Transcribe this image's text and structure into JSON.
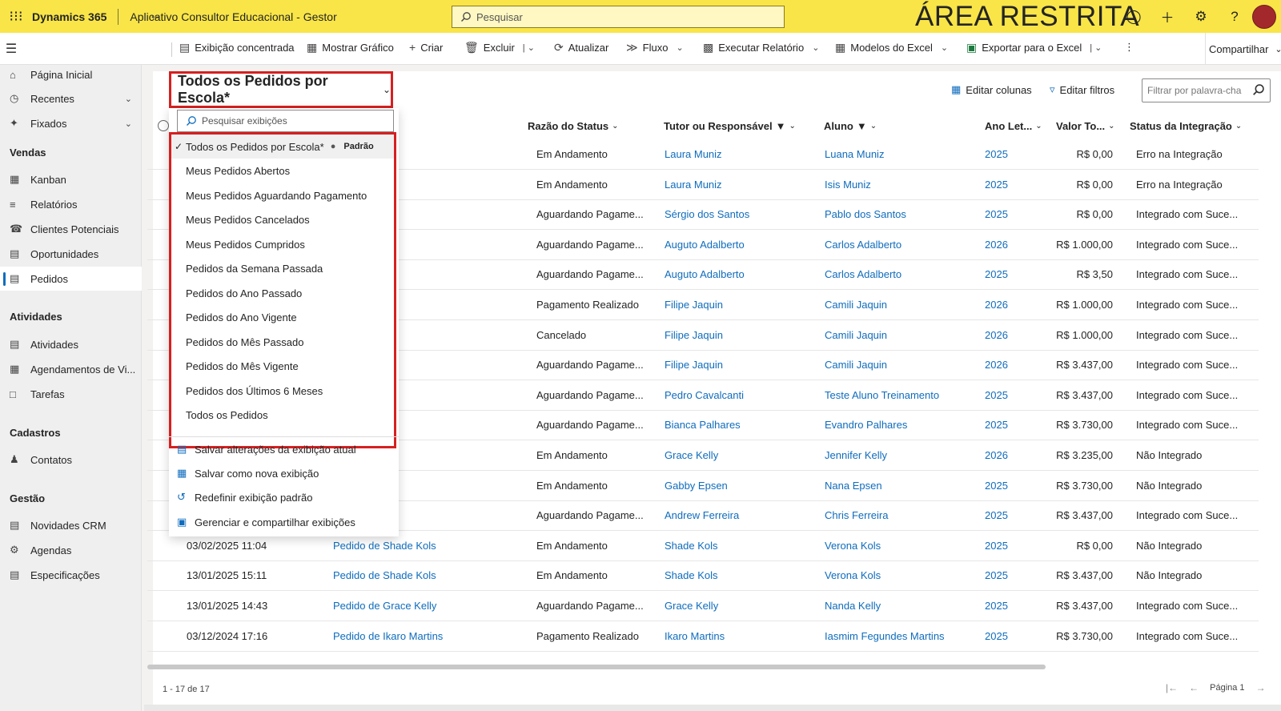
{
  "header": {
    "brand": "Dynamics 365",
    "app_name": "Aplicativo Consultor Educacional - Gestor",
    "search_placeholder": "Pesquisar",
    "restricted_label": "ÁREA RESTRITA"
  },
  "commands": {
    "focused_view": "Exibição concentrada",
    "show_chart": "Mostrar Gráfico",
    "create": "Criar",
    "delete": "Excluir",
    "refresh": "Atualizar",
    "flow": "Fluxo",
    "run_report": "Executar Relatório",
    "excel_templates": "Modelos do Excel",
    "export_excel": "Exportar para o Excel",
    "share": "Compartilhar"
  },
  "sidebar": {
    "home": "Página Inicial",
    "recent": "Recentes",
    "pinned": "Fixados",
    "sections": {
      "sales": "Vendas",
      "activities": "Atividades",
      "registers": "Cadastros",
      "management": "Gestão"
    },
    "items": {
      "kanban": "Kanban",
      "reports": "Relatórios",
      "leads": "Clientes Potenciais",
      "opportunities": "Oportunidades",
      "orders": "Pedidos",
      "activities": "Atividades",
      "visit_schedules": "Agendamentos de Vi...",
      "tasks": "Tarefas",
      "contacts": "Contatos",
      "crm_news": "Novidades CRM",
      "agendas": "Agendas",
      "specs": "Especificações"
    }
  },
  "view": {
    "title": "Todos os Pedidos por Escola*",
    "edit_columns": "Editar colunas",
    "edit_filters": "Editar filtros",
    "keyword_placeholder": "Filtrar por palavra-cha"
  },
  "columns": {
    "status_reason": "Razão do Status",
    "tutor": "Tutor ou Responsável",
    "student": "Aluno",
    "school_year": "Ano Let...",
    "total_value": "Valor To...",
    "integration_status": "Status da Integração"
  },
  "rows": [
    {
      "date": "",
      "order": "a Muniz",
      "status": "Em Andamento",
      "tutor": "Laura Muniz",
      "student": "Luana Muniz",
      "year": "2025",
      "value": "R$ 0,00",
      "integ": "Erro na Integração"
    },
    {
      "date": "",
      "order": "a Muniz",
      "status": "Em Andamento",
      "tutor": "Laura Muniz",
      "student": "Isis Muniz",
      "year": "2025",
      "value": "R$ 0,00",
      "integ": "Erro na Integração"
    },
    {
      "date": "",
      "order": "io dos Santos",
      "status": "Aguardando Pagame...",
      "tutor": "Sérgio dos Santos",
      "student": "Pablo dos Santos",
      "year": "2025",
      "value": "R$ 0,00",
      "integ": "Integrado com Suce..."
    },
    {
      "date": "",
      "order": "uto Adalberto",
      "status": "Aguardando Pagame...",
      "tutor": "Auguto Adalberto",
      "student": "Carlos Adalberto",
      "year": "2026",
      "value": "R$ 1.000,00",
      "integ": "Integrado com Suce..."
    },
    {
      "date": "",
      "order": "uto Adalberto",
      "status": "Aguardando Pagame...",
      "tutor": "Auguto Adalberto",
      "student": "Carlos Adalberto",
      "year": "2025",
      "value": "R$ 3,50",
      "integ": "Integrado com Suce..."
    },
    {
      "date": "",
      "order": "e Jaquin",
      "status": "Pagamento Realizado",
      "tutor": "Filipe Jaquin",
      "student": "Camili Jaquin",
      "year": "2026",
      "value": "R$ 1.000,00",
      "integ": "Integrado com Suce..."
    },
    {
      "date": "",
      "order": "e Jaquin",
      "status": "Cancelado",
      "tutor": "Filipe Jaquin",
      "student": "Camili Jaquin",
      "year": "2026",
      "value": "R$ 1.000,00",
      "integ": "Integrado com Suce..."
    },
    {
      "date": "",
      "order": "e Jaquin",
      "status": "Aguardando Pagame...",
      "tutor": "Filipe Jaquin",
      "student": "Camili Jaquin",
      "year": "2026",
      "value": "R$ 3.437,00",
      "integ": "Integrado com Suce..."
    },
    {
      "date": "",
      "order": "o Cavalcanti",
      "status": "Aguardando Pagame...",
      "tutor": "Pedro Cavalcanti",
      "student": "Teste Aluno Treinamento",
      "year": "2025",
      "value": "R$ 3.437,00",
      "integ": "Integrado com Suce..."
    },
    {
      "date": "",
      "order": "ca Palhares",
      "status": "Aguardando Pagame...",
      "tutor": "Bianca Palhares",
      "student": "Evandro Palhares",
      "year": "2025",
      "value": "R$ 3.730,00",
      "integ": "Integrado com Suce..."
    },
    {
      "date": "",
      "order": "e Kelly",
      "status": "Em Andamento",
      "tutor": "Grace Kelly",
      "student": "Jennifer Kelly",
      "year": "2026",
      "value": "R$ 3.235,00",
      "integ": "Não Integrado"
    },
    {
      "date": "",
      "order": "by Epsen",
      "status": "Em Andamento",
      "tutor": "Gabby Epsen",
      "student": "Nana Epsen",
      "year": "2025",
      "value": "R$ 3.730,00",
      "integ": "Não Integrado"
    },
    {
      "date": "",
      "order": "rew Ferreira",
      "status": "Aguardando Pagame...",
      "tutor": "Andrew Ferreira",
      "student": "Chris Ferreira",
      "year": "2025",
      "value": "R$ 3.437,00",
      "integ": "Integrado com Suce..."
    },
    {
      "date": "03/02/2025 11:04",
      "order": "Pedido de Shade Kols",
      "status": "Em Andamento",
      "tutor": "Shade Kols",
      "student": "Verona Kols",
      "year": "2025",
      "value": "R$ 0,00",
      "integ": "Não Integrado"
    },
    {
      "date": "13/01/2025 15:11",
      "order": "Pedido de Shade Kols",
      "status": "Em Andamento",
      "tutor": "Shade Kols",
      "student": "Verona Kols",
      "year": "2025",
      "value": "R$ 3.437,00",
      "integ": "Não Integrado"
    },
    {
      "date": "13/01/2025 14:43",
      "order": "Pedido de Grace Kelly",
      "status": "Aguardando Pagame...",
      "tutor": "Grace Kelly",
      "student": "Nanda Kelly",
      "year": "2025",
      "value": "R$ 3.437,00",
      "integ": "Integrado com Suce..."
    },
    {
      "date": "03/12/2024 17:16",
      "order": "Pedido de Ikaro Martins",
      "status": "Pagamento Realizado",
      "tutor": "Ikaro Martins",
      "student": "Iasmim Fegundes Martins",
      "year": "2025",
      "value": "R$ 3.730,00",
      "integ": "Integrado com Suce..."
    }
  ],
  "dropdown": {
    "search_placeholder": "Pesquisar exibições",
    "default_badge": "Padrão",
    "views": [
      "Todos os Pedidos por Escola*",
      "Meus Pedidos Abertos",
      "Meus Pedidos Aguardando Pagamento",
      "Meus Pedidos Cancelados",
      "Meus Pedidos Cumpridos",
      "Pedidos da Semana Passada",
      "Pedidos do Ano Passado",
      "Pedidos do Ano Vigente",
      "Pedidos do Mês Passado",
      "Pedidos do Mês Vigente",
      "Pedidos dos Últimos 6 Meses",
      "Todos os Pedidos"
    ],
    "actions": [
      "Salvar alterações da exibição atual",
      "Salvar como nova exibição",
      "Redefinir exibição padrão",
      "Gerenciar e compartilhar exibições"
    ]
  },
  "footer": {
    "count": "1 - 17 de 17",
    "page": "Página 1"
  },
  "colors": {
    "header_bg": "#f9e547",
    "link": "#0f6cbd",
    "highlight_border": "#d62020"
  }
}
